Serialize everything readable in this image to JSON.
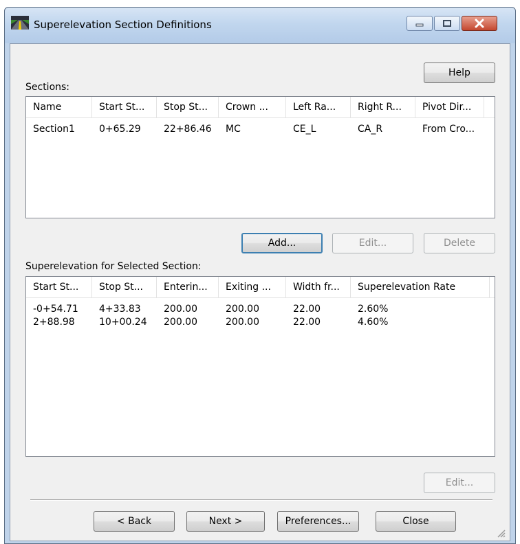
{
  "window": {
    "title": "Superelevation Section Definitions",
    "controls": {
      "minimize": "minimize",
      "maximize": "maximize",
      "close": "close"
    }
  },
  "help_label": "Help",
  "sections": {
    "label": "Sections:",
    "columns": [
      "Name",
      "Start St...",
      "Stop St...",
      "Crown ...",
      "Left Ra...",
      "Right R...",
      "Pivot Dir..."
    ],
    "rows": [
      [
        "Section1",
        "0+65.29",
        "22+86.46",
        "MC",
        "CE_L",
        "CA_R",
        "From Cro..."
      ]
    ]
  },
  "section_buttons": {
    "add": "Add...",
    "edit": "Edit...",
    "delete": "Delete"
  },
  "superelevation": {
    "label": "Superelevation for Selected Section:",
    "columns": [
      "Start St...",
      "Stop St...",
      "Enterin...",
      "Exiting ...",
      "Width fr...",
      "Superelevation Rate"
    ],
    "rows": [
      [
        "-0+54.71",
        "4+33.83",
        "200.00",
        "200.00",
        "22.00",
        "2.60%"
      ],
      [
        "2+88.98",
        "10+00.24",
        "200.00",
        "200.00",
        "22.00",
        "4.60%"
      ]
    ],
    "edit": "Edit..."
  },
  "footer": {
    "back": "< Back",
    "next": "Next >",
    "preferences": "Preferences...",
    "close": "Close"
  },
  "colors": {
    "titlebar": "#c1d6ee",
    "close_button": "#c4472f",
    "dialog_bg": "#f0f0f0"
  }
}
